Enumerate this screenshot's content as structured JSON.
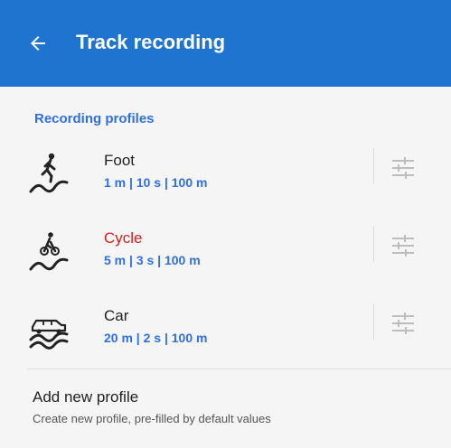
{
  "header": {
    "title": "Track recording"
  },
  "section": {
    "title": "Recording profiles"
  },
  "profiles": [
    {
      "name": "Foot",
      "params": "1 m | 10 s | 100 m",
      "icon": "walking-icon",
      "active": false
    },
    {
      "name": "Cycle",
      "params": "5 m | 3 s | 100 m",
      "icon": "cycling-icon",
      "active": true
    },
    {
      "name": "Car",
      "params": "20 m | 2 s | 100 m",
      "icon": "car-icon",
      "active": false
    }
  ],
  "add_profile": {
    "title": "Add new profile",
    "subtitle": "Create new profile, pre-filled by default values"
  },
  "colors": {
    "appbar": "#1f74cf",
    "accent": "#2f6fe0",
    "active_profile": "#d32020"
  }
}
